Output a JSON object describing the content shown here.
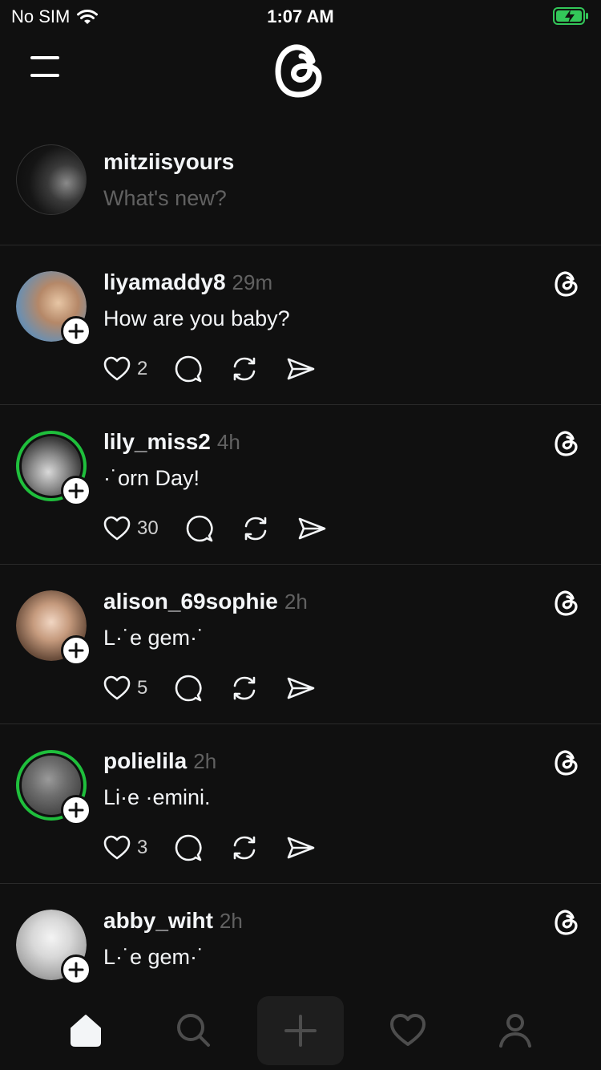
{
  "status_bar": {
    "carrier": "No SIM",
    "time": "1:07 AM"
  },
  "composer": {
    "username": "mitziisyours",
    "placeholder": "What's new?"
  },
  "posts": [
    {
      "username": "liyamaddy8",
      "time": "29m",
      "text": "How are you baby?",
      "likes": "2",
      "avatar_color": "#8b6a52",
      "story_ring": false
    },
    {
      "username": "lily_miss2",
      "time": "4h",
      "text": "·˙orn Day!",
      "likes": "30",
      "avatar_color": "#9a9a9a",
      "story_ring": true
    },
    {
      "username": "alison_69sophie",
      "time": "2h",
      "text": "L·˙e gem·˙",
      "likes": "5",
      "avatar_color": "#b08a72",
      "story_ring": false
    },
    {
      "username": "polielila",
      "time": "2h",
      "text": "Li·e ·emini.",
      "likes": "3",
      "avatar_color": "#7b7b7b",
      "story_ring": true
    },
    {
      "username": "abby_wiht",
      "time": "2h",
      "text": "L·˙e gem·˙",
      "likes": "",
      "avatar_color": "#d6d6d6",
      "story_ring": false
    }
  ],
  "colors": {
    "background": "#101010",
    "text": "#f3f5f7",
    "muted": "#616161",
    "ring": "#1fbf3c",
    "battery": "#33c759"
  },
  "icons": [
    "menu-icon",
    "threads-logo",
    "heart-icon",
    "comment-icon",
    "repost-icon",
    "share-icon",
    "home-icon",
    "search-icon",
    "plus-icon",
    "activity-icon",
    "profile-icon"
  ]
}
